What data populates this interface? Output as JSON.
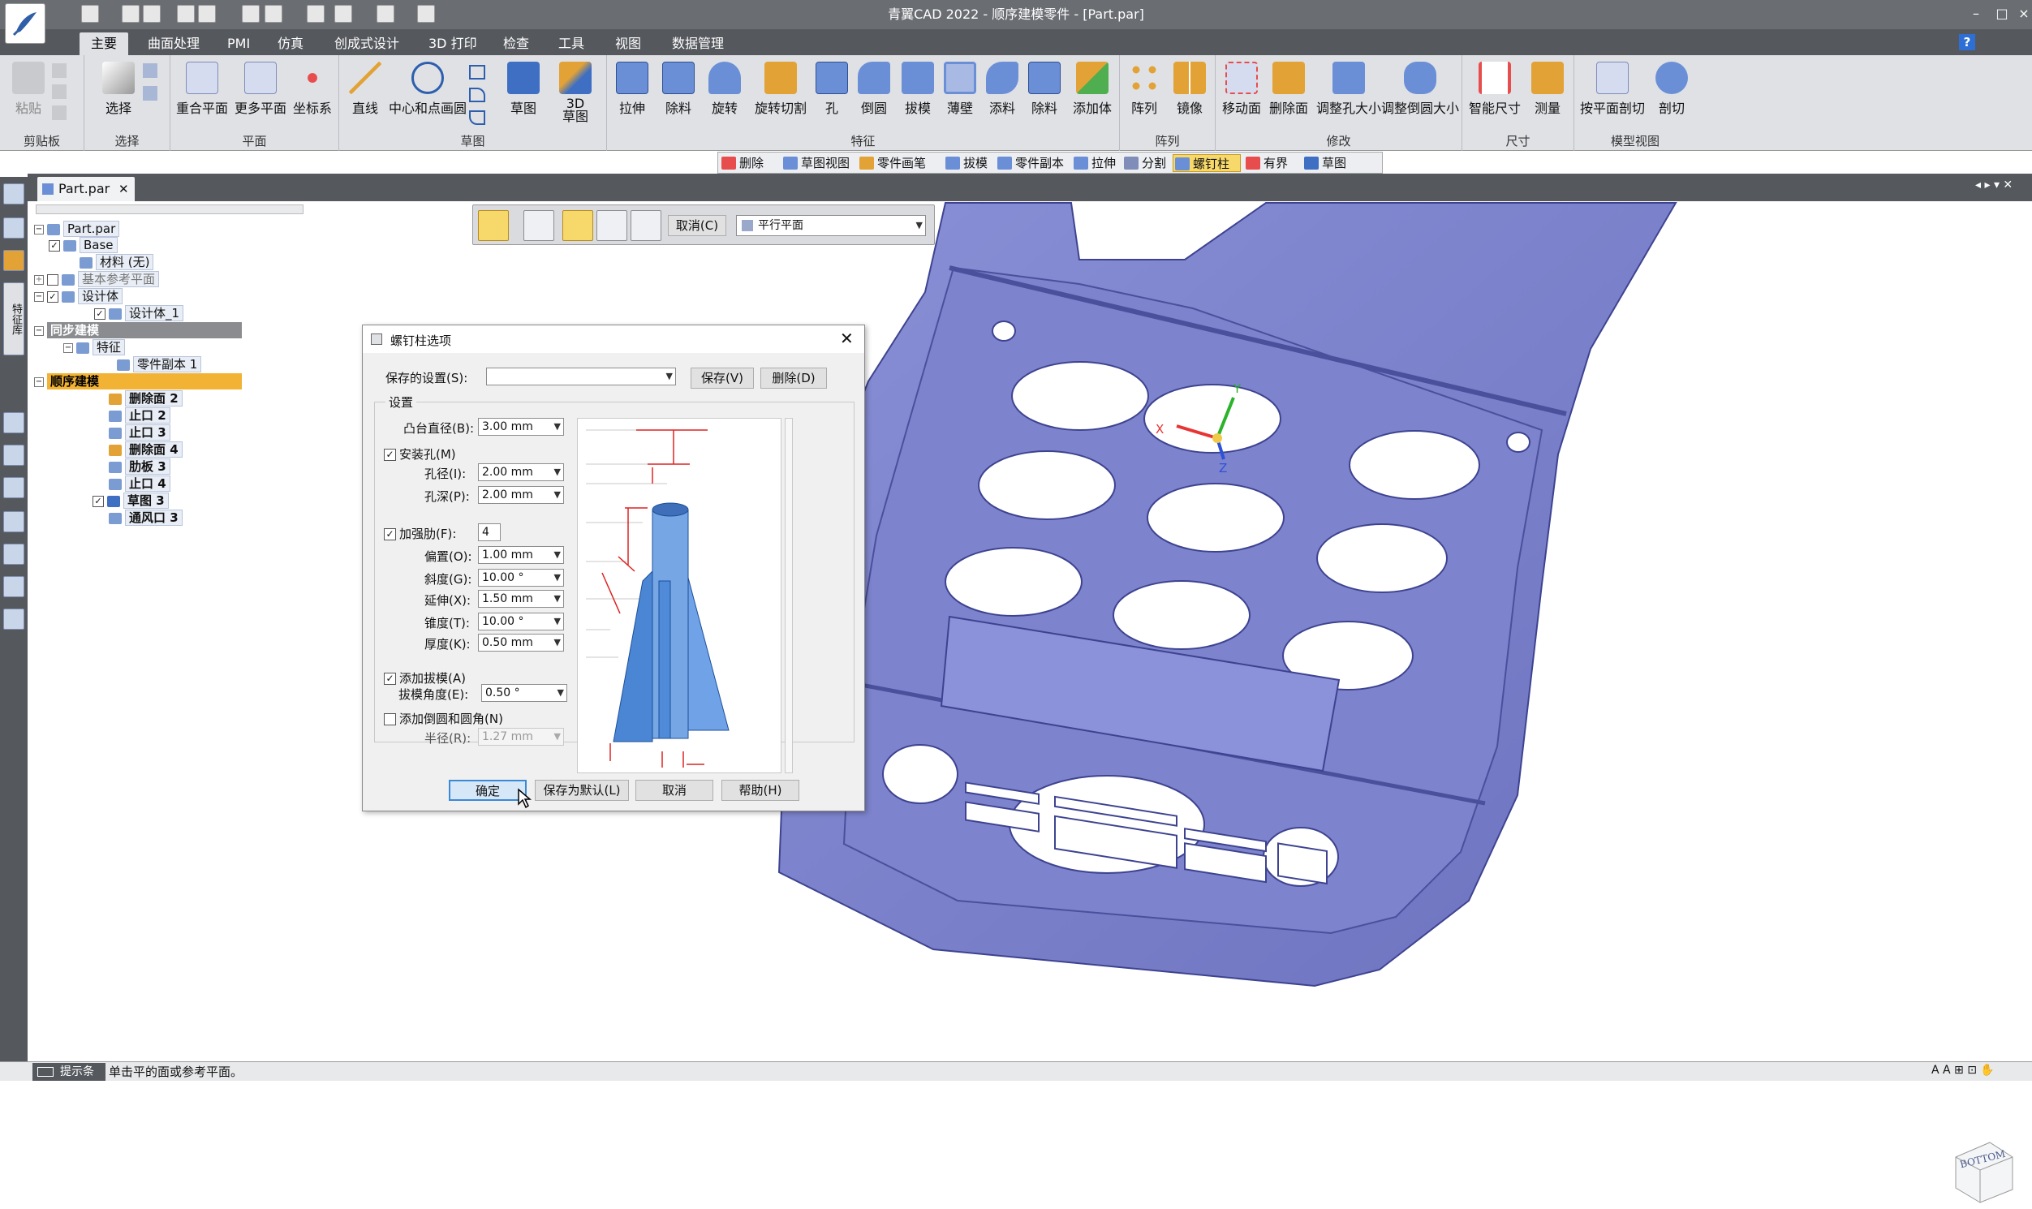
{
  "app": {
    "title": "青翼CAD 2022 - 顺序建模零件 - [Part.par]",
    "accent": "#f7d86a",
    "model_color": "#7e84cc"
  },
  "tabs": [
    "主要",
    "曲面处理",
    "PMI",
    "仿真",
    "创成式设计",
    "3D 打印",
    "检查",
    "工具",
    "视图",
    "数据管理"
  ],
  "ribbon": {
    "groups": [
      {
        "label": "剪贴板",
        "buttons": [
          "粘贴"
        ]
      },
      {
        "label": "选择",
        "buttons": [
          "选择"
        ]
      },
      {
        "label": "平面",
        "buttons": [
          "重合平面",
          "更多平面",
          "坐标系"
        ]
      },
      {
        "label": "草图",
        "buttons": [
          "直线",
          "中心和点画圆",
          "草图",
          "3D\n草图"
        ]
      },
      {
        "label": "特征",
        "buttons": [
          "拉伸",
          "除料",
          "旋转",
          "旋转切割",
          "孔",
          "倒圆",
          "拔模",
          "薄壁",
          "添料",
          "除料",
          "添加体"
        ]
      },
      {
        "label": "阵列",
        "buttons": [
          "阵列",
          "镜像"
        ]
      },
      {
        "label": "修改",
        "buttons": [
          "移动面",
          "删除面",
          "调整孔大小",
          "调整倒圆大小"
        ]
      },
      {
        "label": "尺寸",
        "buttons": [
          "智能尺寸",
          "测量"
        ]
      },
      {
        "label": "模型视图",
        "buttons": [
          "按平面剖切",
          "剖切"
        ]
      }
    ]
  },
  "cmdbar": [
    "删除",
    "草图视图",
    "零件画笔",
    "拔模",
    "零件副本",
    "拉伸",
    "分割",
    "螺钉柱",
    "有界",
    "草图"
  ],
  "doc_tab": "Part.par",
  "tree": {
    "root": "Part.par",
    "base": "Base",
    "material": "材料 (无)",
    "ref_planes": "基本参考平面",
    "design_body_group": "设计体",
    "design_body": "设计体_1",
    "sync": "同步建模",
    "features": "特征",
    "part_copy": "零件副本 1",
    "ordered": "顺序建模",
    "ordered_items": [
      "删除面 2",
      "止口 2",
      "止口 3",
      "删除面 4",
      "肋板 3",
      "止口 4",
      "草图 3",
      "通风口 3"
    ]
  },
  "optbar": {
    "cancel": "取消(C)",
    "plane": "平行平面"
  },
  "dialog": {
    "title": "螺钉柱选项",
    "saved_settings_label": "保存的设置(S):",
    "save": "保存(V)",
    "delete": "删除(D)",
    "settings_title": "设置",
    "boss_dia_label": "凸台直径(B):",
    "boss_dia": "3.00 mm",
    "mount_hole_label": "安装孔(M)",
    "hole_dia_label": "孔径(I):",
    "hole_dia": "2.00 mm",
    "hole_depth_label": "孔深(P):",
    "hole_depth": "2.00 mm",
    "ribs_label": "加强肋(F):",
    "ribs": "4",
    "offset_label": "偏置(O):",
    "offset": "1.00 mm",
    "slope_label": "斜度(G):",
    "slope": "10.00 °",
    "extend_label": "延伸(X):",
    "extend": "1.50 mm",
    "taper_label": "锥度(T):",
    "taper": "10.00 °",
    "thickness_label": "厚度(K):",
    "thickness": "0.50 mm",
    "draft_label": "添加拔模(A)",
    "draft_angle_label": "拔模角度(E):",
    "draft_angle": "0.50 °",
    "fillet_label": "添加倒圆和圆角(N)",
    "radius_label": "半径(R):",
    "radius": "1.27 mm",
    "ok": "确定",
    "save_default": "保存为默认(L)",
    "cancel": "取消",
    "help": "帮助(H)"
  },
  "status": {
    "label": "提示条",
    "message": "单击平的面或参考平面。"
  },
  "navcube": "BOTTOM"
}
